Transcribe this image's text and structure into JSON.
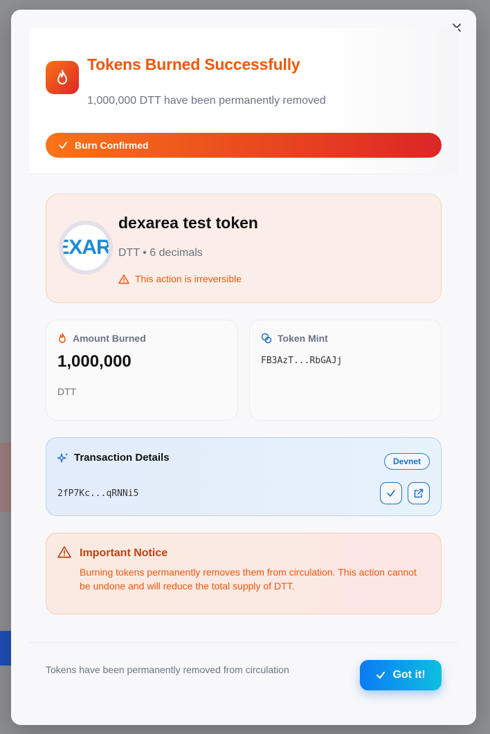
{
  "dialog": {
    "title": "Tokens Burned Successfully",
    "subtitle": "1,000,000 DTT have been permanently removed",
    "confirm_label": "Burn Confirmed",
    "close_icon": "close-icon"
  },
  "token": {
    "name": "dexarea test token",
    "logo_text": "EXAR",
    "meta": "DTT • 6 decimals",
    "warning": "This action is irreversible"
  },
  "amount": {
    "label": "Amount Burned",
    "value": "1,000,000",
    "unit": "DTT"
  },
  "mint": {
    "label": "Token Mint",
    "value": "FB3AzT...RbGAJj"
  },
  "transaction": {
    "title": "Transaction Details",
    "network": "Devnet",
    "hash": "2fP7Kc...qRNNi5"
  },
  "notice": {
    "title": "Important Notice",
    "text": "Burning tokens permanently removes them from circulation. This action cannot be undone and will reduce the total supply of DTT."
  },
  "footer": {
    "text": "Tokens have been permanently removed from circulation",
    "button_label": "Got it!"
  },
  "colors": {
    "accent_orange": "#ea580c",
    "accent_red": "#dc2626",
    "accent_blue": "#0a7bf5"
  }
}
